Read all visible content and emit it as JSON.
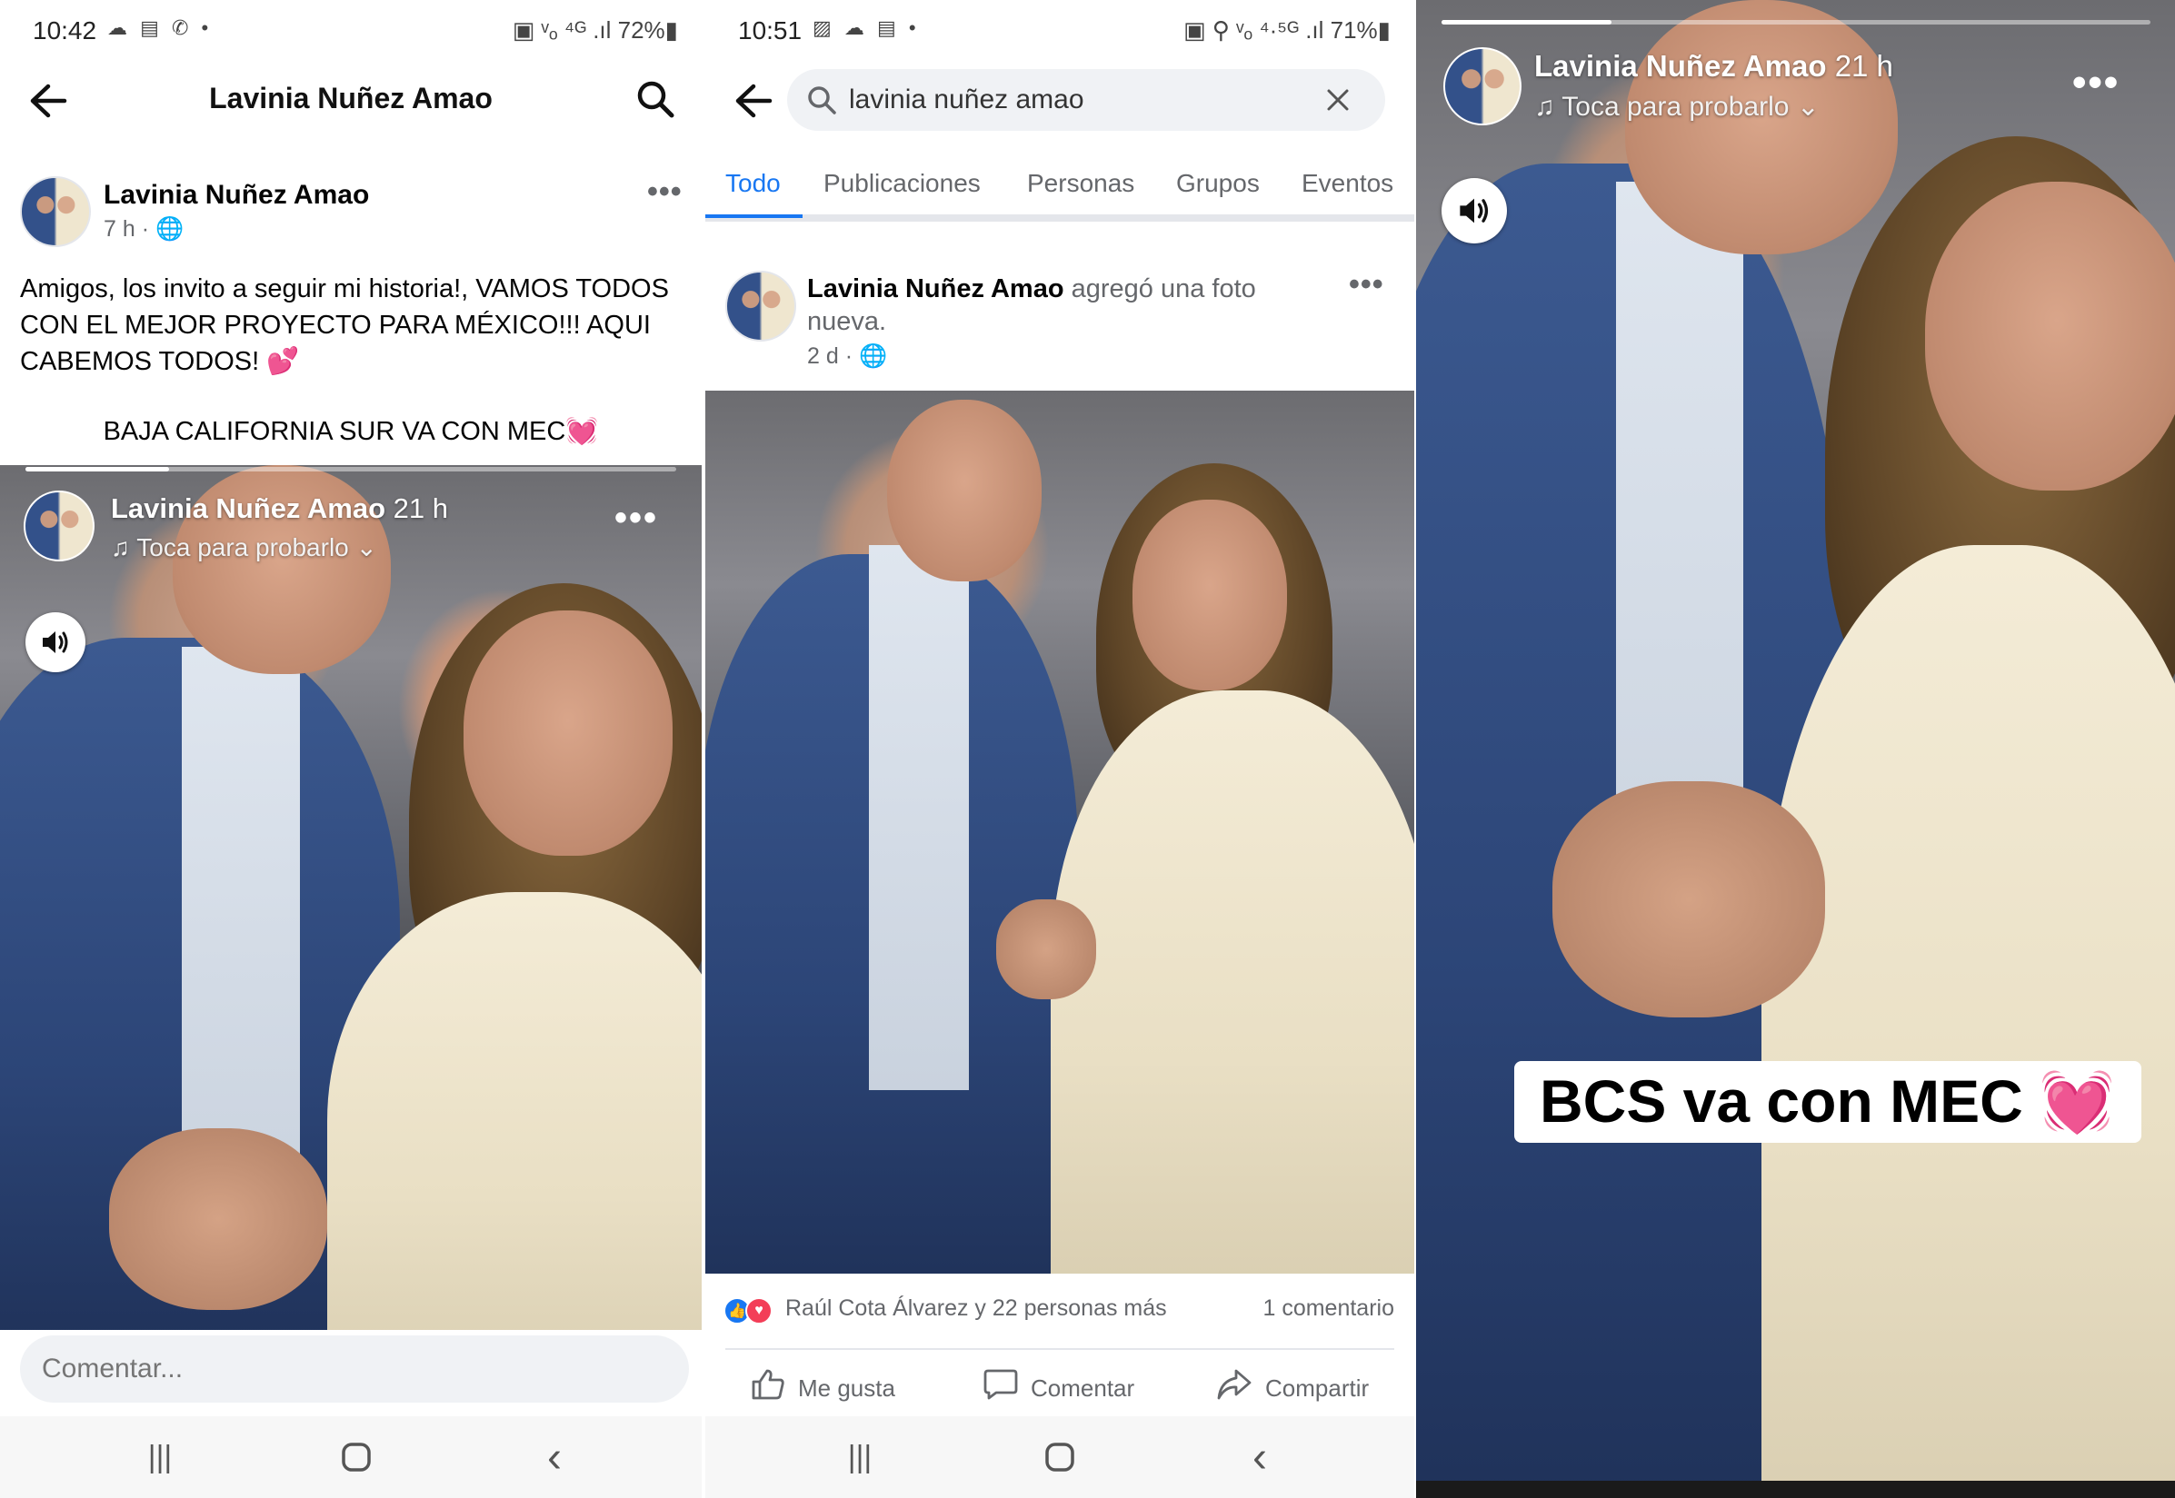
{
  "panel1": {
    "status": {
      "time": "10:42",
      "left_icons": "☁ ▤ ✆ •",
      "right": "▣ ᵛₒ ⁴ᴳ .ıl 72%▮"
    },
    "header": {
      "title": "Lavinia Nuñez Amao"
    },
    "post": {
      "author": "Lavinia Nuñez Amao",
      "meta": "7 h · 🌐",
      "text": "Amigos, los invito a seguir mi historia!, VAMOS TODOS CON EL MEJOR PROYECTO PARA MÉXICO!!! AQUI CABEMOS TODOS! 💕",
      "text2": "BAJA CALIFORNIA SUR VA CON MEC💓"
    },
    "story": {
      "name": "Lavinia Nuñez Amao",
      "time": "21 h",
      "music": "♫ Toca para probarlo ⌄"
    },
    "comment": {
      "placeholder": "Comentar..."
    }
  },
  "panel2": {
    "status": {
      "time": "10:51",
      "left_icons": "▨ ☁ ▤ •",
      "right": "▣ ⚲ ᵛₒ ⁴·⁵ᴳ .ıl 71%▮"
    },
    "search": {
      "value": "lavinia nuñez amao"
    },
    "tabs": [
      "Todo",
      "Publicaciones",
      "Personas",
      "Grupos",
      "Eventos"
    ],
    "post": {
      "author": "Lavinia Nuñez Amao",
      "action": "agregó una foto nueva.",
      "meta": "2 d · 🌐"
    },
    "reactions": {
      "text": "Raúl Cota Álvarez y 22 personas más",
      "comments": "1 comentario"
    },
    "actions": {
      "like": "Me gusta",
      "comment": "Comentar",
      "share": "Compartir"
    }
  },
  "panel3": {
    "story": {
      "name": "Lavinia Nuñez Amao",
      "time": "21 h",
      "music": "♫ Toca para probarlo ⌄"
    },
    "caption": "BCS va con MEC 💓"
  },
  "nav": {
    "recents": "|||",
    "home": "○",
    "back": "‹"
  },
  "colors": {
    "fb_blue": "#1877f2",
    "gray_text": "#65676b",
    "input_bg": "#f0f2f5"
  }
}
